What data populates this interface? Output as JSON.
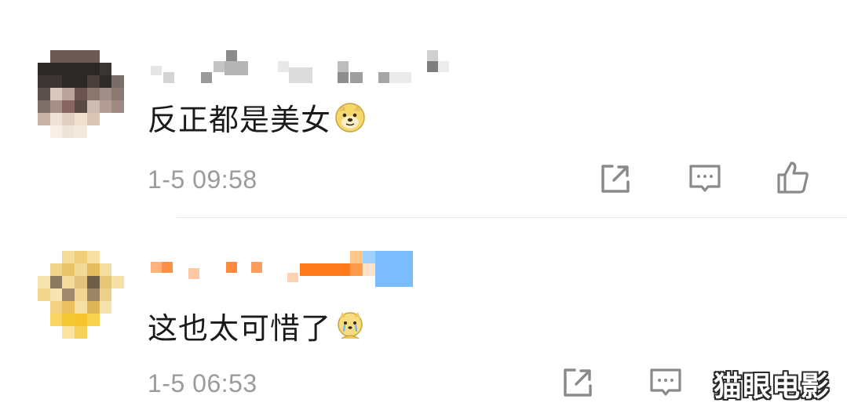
{
  "comments": [
    {
      "text": "反正都是美女",
      "emoji": "doge-face-emoji",
      "time": "1-5 09:58",
      "actions": [
        "share-icon",
        "comment-icon",
        "like-icon"
      ]
    },
    {
      "text": "这也太可惜了",
      "emoji": "crying-doge-emoji",
      "time": "1-5 06:53",
      "actions": [
        "share-icon",
        "comment-icon"
      ]
    }
  ],
  "watermark": "猫眼电影",
  "colors": {
    "text": "#1a1a1a",
    "time": "#9b9b9b",
    "icon": "#8a8a8a",
    "divider": "#e8e8e8",
    "name_orange": "#ff7a1a",
    "name_blue": "#7bbcff"
  }
}
